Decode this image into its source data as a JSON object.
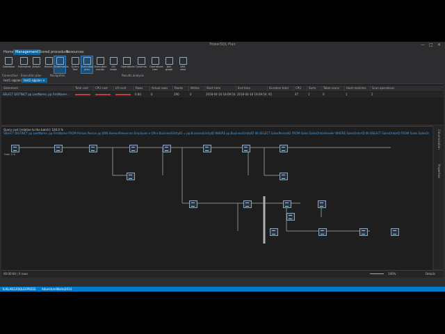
{
  "window": {
    "title": "PowerSQL Plan",
    "min": "—",
    "max": "□",
    "close": "✕"
  },
  "menu": [
    "Home",
    "Management",
    "Stored procedure",
    "Resources"
  ],
  "ribbon": {
    "buttons": [
      {
        "label": "Database"
      },
      {
        "label": "Estimated"
      },
      {
        "label": "Actual"
      },
      {
        "label": "History"
      },
      {
        "label": "Statements"
      },
      {
        "label": "Query Text"
      },
      {
        "label": "Execution plan"
      },
      {
        "label": "Execution results"
      },
      {
        "label": "I/O reads"
      },
      {
        "label": "Operations"
      },
      {
        "label": "Columns"
      },
      {
        "label": "Operations tree"
      },
      {
        "label": "Join graph"
      },
      {
        "label": "XML view"
      }
    ],
    "groups": [
      "Connection",
      "Execution plan",
      "Navigation",
      "Results analysis"
    ]
  },
  "doc_tabs": [
    "test1.sqlplan",
    "test2.sqlplan ✕"
  ],
  "grid": {
    "headers": [
      "Statement",
      "Total cost",
      "CPU cost",
      "I/O cost",
      "Rows",
      "Actual rows",
      "Reads",
      "Writes",
      "Start time",
      "End time",
      "Duration total",
      "CPU",
      "Sorts",
      "Table scans",
      "Hash matches",
      "Scan operations"
    ],
    "row": [
      "SELECT DISTINCT pp.LastName, pp.FirstName...",
      "",
      "",
      "",
      "6.84",
      "6",
      "290",
      "0",
      "2018-04-16 18:09:54.551",
      "2018-04-16 18:09:54.647",
      "95",
      "47",
      "1",
      "0",
      "1",
      "2"
    ]
  },
  "plan": {
    "cost_line": "Query cost (relative to the batch): 100.0 %",
    "query_text": "SELECT DISTINCT pp.LastName, pp.FirstName FROM Person.Person pp JOIN HumanResources.Employee e ON e.BusinessEntityID = pp.BusinessEntityID WHERE pp.BusinessEntityID IN (SELECT SalesPersonID FROM Sales.SalesOrderHeader WHERE SalesOrderID IN (SELECT SalesOrderID FROM Sales.SalesOrderDetail WHERE ProductID IN ..."
  },
  "rail": [
    "Columnization",
    "Properties"
  ],
  "status": {
    "rows": "00:00:00 | 0 rows",
    "zoom": "100%",
    "details": "Details"
  },
  "taskbar": {
    "server": "ILIKLAB13\\SQLEXPRESS",
    "database": "AdventureWorks2014"
  }
}
